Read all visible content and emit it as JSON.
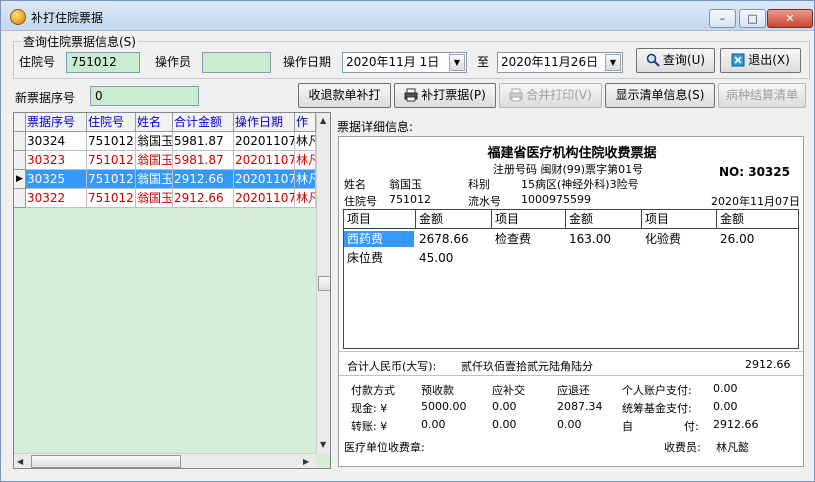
{
  "window": {
    "title": "补打住院票据",
    "minimize": "–",
    "maximize": "□",
    "close": "✕"
  },
  "query": {
    "group_label": "查询住院票据信息(S)",
    "admission_label": "住院号",
    "admission_value": "751012",
    "operator_label": "操作员",
    "operator_value": "",
    "date_label": "操作日期",
    "date_from": "2020年11月 1日",
    "to_label": "至",
    "date_to": "2020年11月26日",
    "search_button": "查询(U)",
    "exit_button": "退出(X)"
  },
  "toolbar": {
    "new_no_label": "新票据序号",
    "new_no_value": "0",
    "refund_reprint": "收退款单补打",
    "reprint": "补打票据(P)",
    "merge_print": "合并打印(V)",
    "show_list": "显示清单信息(S)",
    "disease_settle": "病种结算清单"
  },
  "grid": {
    "headers": [
      "票据序号",
      "住院号",
      "姓名",
      "合计金额",
      "操作日期",
      "作"
    ],
    "rows": [
      {
        "cells": [
          "30324",
          "751012",
          "翁国玉",
          "5981.87",
          "20201107",
          "林凡"
        ],
        "style": "normal",
        "marker": ""
      },
      {
        "cells": [
          "30323",
          "751012",
          "翁国玉",
          "5981.87",
          "20201107",
          "林凡"
        ],
        "style": "red",
        "marker": ""
      },
      {
        "cells": [
          "30325",
          "751012",
          "翁国玉",
          "2912.66",
          "20201107",
          "林凡"
        ],
        "style": "sel",
        "marker": "▶"
      },
      {
        "cells": [
          "30322",
          "751012",
          "翁国玉",
          "2912.66",
          "20201107",
          "林凡"
        ],
        "style": "red",
        "marker": ""
      }
    ]
  },
  "ticket": {
    "panel_label": "票据详细信息:",
    "title": "福建省医疗机构住院收费票据",
    "reg_code": "注册号码 闽财(99)票字第01号",
    "no_label": "NO: 30325",
    "name_label": "姓名",
    "name_value": "翁国玉",
    "dept_label": "科别",
    "dept_value": "15病区(神经外科)3险号",
    "admission_label": "住院号",
    "admission_value": "751012",
    "serial_label": "流水号",
    "serial_value": "1000975599",
    "date": "2020年11月07日",
    "item_headers": [
      "项目",
      "金额",
      "项目",
      "金额",
      "项目",
      "金额"
    ],
    "items": [
      {
        "name": "西药费",
        "amount": "2678.66"
      },
      {
        "name": "检查费",
        "amount": "163.00"
      },
      {
        "name": "化验费",
        "amount": "26.00"
      },
      {
        "name": "床位费",
        "amount": "45.00"
      }
    ],
    "total_label": "合计人民币(大写):",
    "total_words": "贰仟玖佰壹拾贰元陆角陆分",
    "total_amount": "2912.66",
    "pay_method": "付款方式",
    "prepaid": "预收款",
    "supplement": "应补交",
    "refund": "应退还",
    "personal_account": "个人账户支付:",
    "personal_account_value": "0.00",
    "cash_label": "现金: ¥",
    "cash_prepaid": "5000.00",
    "cash_supplement": "0.00",
    "cash_refund": "2087.34",
    "fund_label": "统筹基金支付:",
    "fund_value": "0.00",
    "transfer_label": "转账: ¥",
    "transfer_prepaid": "0.00",
    "transfer_supplement": "0.00",
    "transfer_refund": "0.00",
    "self_label": "自",
    "self_pay_label": "付:",
    "self_value": "2912.66",
    "seal_label": "医疗单位收费章:",
    "cashier_label": "收费员:",
    "cashier_value": "林凡懿"
  },
  "colors": {
    "accent": "#3399ff",
    "grid_bg": "#d5ecd7",
    "field_bg": "#c9eccf",
    "red_text": "#cc0000"
  }
}
